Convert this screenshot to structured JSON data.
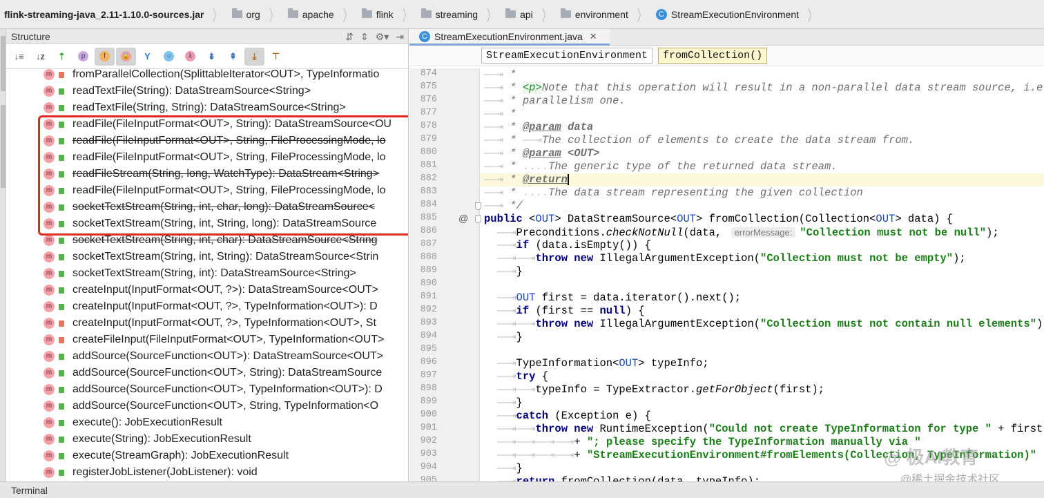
{
  "breadcrumb": {
    "root": "flink-streaming-java_2.11-1.10.0-sources.jar",
    "folders": [
      "org",
      "apache",
      "flink",
      "streaming",
      "api",
      "environment"
    ],
    "class_name": "StreamExecutionEnvironment",
    "class_badge": "C"
  },
  "structure": {
    "title": "Structure",
    "toolbar": [
      {
        "icon": "sort-visibility-icon",
        "glyph": "↓≡"
      },
      {
        "icon": "sort-alphabetically-icon",
        "glyph": "↓z"
      },
      {
        "icon": "show-inherited-icon",
        "glyph": "⇡"
      },
      {
        "icon": "show-properties-icon",
        "glyph": "p"
      },
      {
        "icon": "show-fields-icon",
        "glyph": "f"
      },
      {
        "icon": "show-non-public-icon",
        "glyph": "🔒"
      },
      {
        "icon": "show-hierarchy-icon",
        "glyph": "Y"
      },
      {
        "icon": "show-anonymous-icon",
        "glyph": "○"
      },
      {
        "icon": "show-lambdas-icon",
        "glyph": "λ"
      },
      {
        "icon": "expand-all-icon",
        "glyph": "⇟"
      },
      {
        "icon": "collapse-all-icon",
        "glyph": "⇞"
      },
      {
        "icon": "autoscroll-to-source-icon",
        "glyph": "⤓"
      },
      {
        "icon": "autoscroll-from-source-icon",
        "glyph": "⊤"
      }
    ],
    "items": [
      {
        "sig": "fromParallelCollection(SplittableIterator<OUT>, TypeInformatio",
        "vis": "private",
        "deprecated": false
      },
      {
        "sig": "readTextFile(String): DataStreamSource<String>",
        "vis": "public",
        "deprecated": false
      },
      {
        "sig": "readTextFile(String, String): DataStreamSource<String>",
        "vis": "public",
        "deprecated": false
      },
      {
        "sig": "readFile(FileInputFormat<OUT>, String): DataStreamSource<OU",
        "vis": "public",
        "deprecated": false
      },
      {
        "sig": "readFile(FileInputFormat<OUT>, String, FileProcessingMode, lo",
        "vis": "public",
        "deprecated": true
      },
      {
        "sig": "readFile(FileInputFormat<OUT>, String, FileProcessingMode, lo",
        "vis": "public",
        "deprecated": false
      },
      {
        "sig": "readFileStream(String, long, WatchType): DataStream<String>",
        "vis": "public",
        "deprecated": true
      },
      {
        "sig": "readFile(FileInputFormat<OUT>, String, FileProcessingMode, lo",
        "vis": "public",
        "deprecated": false
      },
      {
        "sig": "socketTextStream(String, int, char, long): DataStreamSource<",
        "vis": "public",
        "deprecated": true
      },
      {
        "sig": "socketTextStream(String, int, String, long): DataStreamSource",
        "vis": "public",
        "deprecated": false
      },
      {
        "sig": "socketTextStream(String, int, char): DataStreamSource<String",
        "vis": "public",
        "deprecated": true
      },
      {
        "sig": "socketTextStream(String, int, String): DataStreamSource<Strin",
        "vis": "public",
        "deprecated": false
      },
      {
        "sig": "socketTextStream(String, int): DataStreamSource<String>",
        "vis": "public",
        "deprecated": false
      },
      {
        "sig": "createInput(InputFormat<OUT, ?>): DataStreamSource<OUT>",
        "vis": "public",
        "deprecated": false
      },
      {
        "sig": "createInput(InputFormat<OUT, ?>, TypeInformation<OUT>): D",
        "vis": "public",
        "deprecated": false
      },
      {
        "sig": "createInput(InputFormat<OUT, ?>, TypeInformation<OUT>, St",
        "vis": "private",
        "deprecated": false
      },
      {
        "sig": "createFileInput(FileInputFormat<OUT>, TypeInformation<OUT>",
        "vis": "private",
        "deprecated": false
      },
      {
        "sig": "addSource(SourceFunction<OUT>): DataStreamSource<OUT>",
        "vis": "public",
        "deprecated": false
      },
      {
        "sig": "addSource(SourceFunction<OUT>, String): DataStreamSource",
        "vis": "public",
        "deprecated": false
      },
      {
        "sig": "addSource(SourceFunction<OUT>, TypeInformation<OUT>): D",
        "vis": "public",
        "deprecated": false
      },
      {
        "sig": "addSource(SourceFunction<OUT>, String, TypeInformation<O",
        "vis": "public",
        "deprecated": false
      },
      {
        "sig": "execute(): JobExecutionResult",
        "vis": "public",
        "deprecated": false
      },
      {
        "sig": "execute(String): JobExecutionResult",
        "vis": "public",
        "deprecated": false
      },
      {
        "sig": "execute(StreamGraph): JobExecutionResult",
        "vis": "public",
        "deprecated": false
      },
      {
        "sig": "registerJobListener(JobListener): void",
        "vis": "public",
        "deprecated": false
      }
    ],
    "method_badge": "m"
  },
  "editor": {
    "tab_label": "StreamExecutionEnvironment.java",
    "tab_close": "✕",
    "tab_badge": "C",
    "code_breadcrumbs": [
      "StreamExecutionEnvironment",
      "fromCollection()"
    ],
    "lines": [
      {
        "n": "874",
        "html": "<span class='ws'>——⇥ </span><span class='cmt'>*</span>"
      },
      {
        "n": "875",
        "html": "<span class='ws'>——⇥ </span><span class='cmt'>* </span><span class='tag'>&lt;p&gt;</span><span class='cmt'>Note that this operation will result in a non-parallel data stream source, i.e. a</span>"
      },
      {
        "n": "876",
        "html": "<span class='ws'>——⇥ </span><span class='cmt'>* parallelism one.</span>"
      },
      {
        "n": "877",
        "html": "<span class='ws'>——⇥ </span><span class='cmt'>*</span>"
      },
      {
        "n": "878",
        "html": "<span class='ws'>——⇥ </span><span class='cmt'>* </span><span class='cmt' style='text-decoration:underline;font-weight:bold'>@param</span><span class='cmt' style='font-weight:bold'> data</span>"
      },
      {
        "n": "879",
        "html": "<span class='ws'>——⇥ </span><span class='cmt'>* </span><span class='ws'>——⇥</span><span class='cmt'>The collection of elements to create the data stream from.</span>"
      },
      {
        "n": "880",
        "html": "<span class='ws'>——⇥ </span><span class='cmt'>* </span><span class='cmt' style='text-decoration:underline;font-weight:bold'>@param</span><span class='cmt' style='font-weight:bold'> &lt;OUT&gt;</span>"
      },
      {
        "n": "881",
        "html": "<span class='ws'>——⇥ </span><span class='cmt'>* </span><span class='ws'>....</span><span class='cmt'>The generic type of the returned data stream.</span>"
      },
      {
        "n": "882",
        "html": "<span class='ws'>——⇥ </span><span class='cmt'>* </span><span class='cmt' style='text-decoration:underline;font-weight:bold'>@return</span><span class='cursor'></span>",
        "current": true
      },
      {
        "n": "883",
        "html": "<span class='ws'>——⇥ </span><span class='cmt'>* </span><span class='ws'>....</span><span class='cmt'>The data stream representing the given collection</span>"
      },
      {
        "n": "884",
        "html": "<span class='ws'>——⇥ </span><span class='cmt'>*/</span>"
      },
      {
        "n": "885",
        "html": "<span class='kw'>public</span> &lt;<span class='tp'>OUT</span>&gt; DataStreamSource&lt;<span class='tp'>OUT</span>&gt; fromCollection(Collection&lt;<span class='tp'>OUT</span>&gt; data) {",
        "mark": "@"
      },
      {
        "n": "886",
        "html": "<span class='ws'>  ——⇥</span>Preconditions.<span class='it'>checkNotNull</span>(data, <span class='hint'>errorMessage:</span><span class='str'>\"Collection must not be null\"</span>);"
      },
      {
        "n": "887",
        "html": "<span class='ws'>  ——⇥</span><span class='kw'>if</span> (data.isEmpty()) {"
      },
      {
        "n": "888",
        "html": "<span class='ws'>  ——⇥——⇥</span><span class='kw'>throw new</span> IllegalArgumentException(<span class='str'>\"Collection must not be empty\"</span>);"
      },
      {
        "n": "889",
        "html": "<span class='ws'>  ——⇥</span>}"
      },
      {
        "n": "890",
        "html": ""
      },
      {
        "n": "891",
        "html": "<span class='ws'>  ——⇥</span><span class='tp'>OUT</span> first = data.iterator().next();"
      },
      {
        "n": "892",
        "html": "<span class='ws'>  ——⇥</span><span class='kw'>if</span> (first == <span class='kw'>null</span>) {"
      },
      {
        "n": "893",
        "html": "<span class='ws'>  ——⇥——⇥</span><span class='kw'>throw new</span> IllegalArgumentException(<span class='str'>\"Collection must not contain null elements\"</span>);"
      },
      {
        "n": "894",
        "html": "<span class='ws'>  ——⇥</span>}"
      },
      {
        "n": "895",
        "html": ""
      },
      {
        "n": "896",
        "html": "<span class='ws'>  ——⇥</span>TypeInformation&lt;<span class='tp'>OUT</span>&gt; typeInfo;"
      },
      {
        "n": "897",
        "html": "<span class='ws'>  ——⇥</span><span class='kw'>try</span> {"
      },
      {
        "n": "898",
        "html": "<span class='ws'>  ——⇥——⇥</span>typeInfo = TypeExtractor.<span class='it'>getForObject</span>(first);"
      },
      {
        "n": "899",
        "html": "<span class='ws'>  ——⇥</span>}"
      },
      {
        "n": "900",
        "html": "<span class='ws'>  ——⇥</span><span class='kw'>catch</span> (Exception e) {"
      },
      {
        "n": "901",
        "html": "<span class='ws'>  ——⇥——⇥</span><span class='kw'>throw new</span> RuntimeException(<span class='str'>\"Could not create TypeInformation for type \"</span> + first.ge"
      },
      {
        "n": "902",
        "html": "<span class='ws'>  ——⇥——⇥——⇥——⇥</span>+ <span class='str'>\"; please specify the TypeInformation manually via \"</span>"
      },
      {
        "n": "903",
        "html": "<span class='ws'>  ——⇥——⇥——⇥——⇥</span>+ <span class='str'>\"StreamExecutionEnvironment#fromElements(Collection, TypeInformation)\"</span>"
      },
      {
        "n": "904",
        "html": "<span class='ws'>  ——⇥</span>}"
      },
      {
        "n": "905",
        "html": "<span class='ws'>  ——⇥</span><span class='kw'>return</span> fromCollection(data, typeInfo);"
      }
    ]
  },
  "watermark": {
    "line1": "@ 极AI教育",
    "line2": "@稀土掘金技术社区"
  },
  "bottom_bar": {
    "terminal_label": "Terminal"
  },
  "colors": {
    "highlight_box": "#e0281e",
    "method_badge": "#f2a3a9",
    "public": "#54b04c",
    "private": "#e0785d"
  }
}
